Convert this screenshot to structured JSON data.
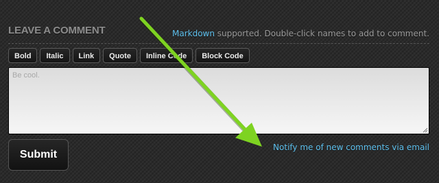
{
  "comment_form": {
    "heading": "LEAVE A COMMENT",
    "note": {
      "link": "Markdown",
      "text": " supported. Double-click names to add to comment."
    },
    "toolbar": [
      "Bold",
      "Italic",
      "Link",
      "Quote",
      "Inline Code",
      "Block Code"
    ],
    "textarea_placeholder": "Be cool.",
    "submit_label": "Submit",
    "notify_link": "Notify me of new comments via email"
  },
  "annotation": {
    "icon": "arrow-icon",
    "color": "#7ed321"
  },
  "colors": {
    "link": "#5fc1ee",
    "heading": "#8c8c8c"
  }
}
